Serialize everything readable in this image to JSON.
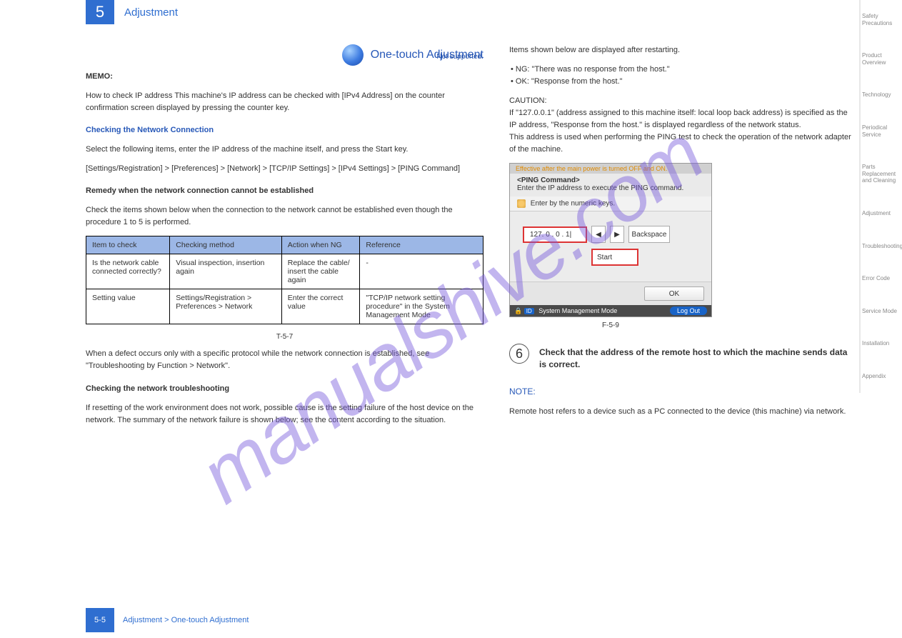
{
  "chapter": {
    "number": "5",
    "title": "Adjustment"
  },
  "sideTabs": [
    "Safety Precautions",
    "Product Overview",
    "Technology",
    "Periodical Service",
    "Parts Replacement and Cleaning",
    "Adjustment",
    "Troubleshooting",
    "Error Code",
    "Service Mode",
    "Installation",
    "Appendix"
  ],
  "left": {
    "memoTitle": "MEMO:",
    "memoBody": "How to check IP address\nThis machine's IP address can be checked with [IPv4 Address] on the counter confirmation screen displayed by pressing the counter key.",
    "remedyTitle": "Remedy when the network connection cannot be established",
    "remedyBody": "Check the items shown below when the connection to the network cannot be established even though the procedure 1 to 5 is performed.",
    "table": {
      "headers": [
        "Item to check",
        "Checking method",
        "Action when NG",
        "Reference"
      ],
      "rows": [
        [
          "Is the network cable connected correctly?",
          "Visual inspection, insertion again",
          "Replace the cable/ insert the cable again",
          "-"
        ],
        [
          "Setting value",
          "Settings/Registration > Preferences > Network",
          "Enter the correct value",
          "\"TCP/IP network setting procedure\" in the System Management Mode"
        ]
      ],
      "caption": "T-5-7"
    },
    "h_right": "One-touch Adjustment",
    "h_right_sub": "Not supported.",
    "sectionTitle": "Checking the Network Connection",
    "op": "Select the following items, enter the IP address of the machine itself, and press the Start key.",
    "opPath": "[Settings/Registration] > [Preferences] > [Network] > [TCP/IP Settings] > [IPv4 Settings] > [PING Command]",
    "tableNote": "When a defect occurs only with a specific protocol while the network connection is established, see \"Troubleshooting by Function > Network\".",
    "remedy2Title": "Checking the network troubleshooting",
    "remedy2Body": "If resetting of the work environment does not work, possible cause is the setting failure of the host device on the network. The summary of the network failure is shown below; see the content according to the situation."
  },
  "right": {
    "listNote": "Items shown below are displayed after restarting.",
    "ng": "NG: \"There was no response from the host.\"",
    "ok": "OK: \"Response from the host.\"",
    "caution": "CAUTION:\nIf \"127.0.0.1\" (address assigned to this machine itself: local loop back address) is specified as the IP address, \"Response from the host.\" is displayed regardless of the network status.\nThis address is used when performing the PING test to check the operation of the network adapter of the machine.",
    "figCaption": "F-5-9",
    "step": {
      "num": "6",
      "text": "Check that the address of the remote host to which the machine sends data is correct."
    },
    "noteTitle": "NOTE:",
    "noteBody": "Remote host refers to a device such as a PC connected to the device (this machine) via network."
  },
  "dialog": {
    "topMsg": "Effective after the main power is turned OFF and ON.",
    "head1": "<PING Command>",
    "head2": "Enter the IP address to execute the PING command.",
    "hint": "Enter by the numeric keys.",
    "ip": "127. 0   . 0   . 1|",
    "backspace": "Backspace",
    "start": "Start",
    "ok": "OK",
    "status": "System Management Mode",
    "id": "ID",
    "logout": "Log Out"
  },
  "footer": {
    "page": "5-5",
    "text": "Adjustment > One-touch Adjustment"
  }
}
